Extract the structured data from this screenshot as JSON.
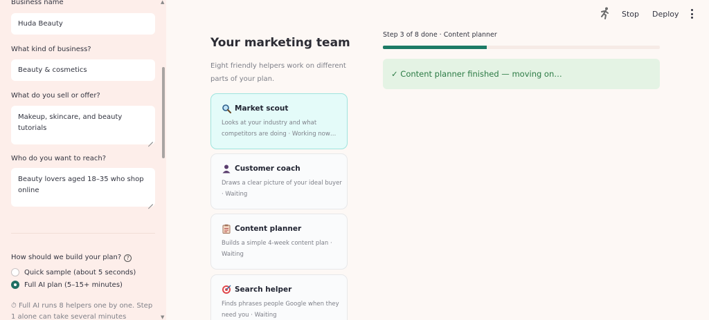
{
  "sidebar": {
    "business_name": {
      "label": "Business name",
      "value": "Huda Beauty"
    },
    "business_kind": {
      "label": "What kind of business?",
      "value": "Beauty & cosmetics"
    },
    "offer": {
      "label": "What do you sell or offer?",
      "value": "Makeup, skincare, and beauty tutorials"
    },
    "audience": {
      "label": "Who do you want to reach?",
      "value": "Beauty lovers aged 18–35 who shop online"
    },
    "build_plan": {
      "label": "How should we build your plan?",
      "help_glyph": "?",
      "options": [
        {
          "label": "Quick sample (about 5 seconds)",
          "selected": false
        },
        {
          "label": "Full AI plan (5–15+ minutes)",
          "selected": true
        }
      ]
    },
    "note": "⏱ Full AI runs 8 helpers one by one. Step 1 alone can take several minutes"
  },
  "toolbar": {
    "stop_label": "Stop",
    "deploy_label": "Deploy"
  },
  "team": {
    "title": "Your marketing team",
    "subtitle": "Eight friendly helpers work on different parts of your plan.",
    "helpers": [
      {
        "icon": "magnifier-icon",
        "name": "Market scout",
        "desc": "Looks at your industry and what competitors are doing · Working now…",
        "active": true
      },
      {
        "icon": "person-icon",
        "name": "Customer coach",
        "desc": "Draws a clear picture of your ideal buyer · Waiting",
        "active": false
      },
      {
        "icon": "clipboard-icon",
        "name": "Content planner",
        "desc": "Builds a simple 4-week content plan · Waiting",
        "active": false
      },
      {
        "icon": "target-icon",
        "name": "Search helper",
        "desc": "Finds phrases people Google when they need you · Waiting",
        "active": false
      }
    ]
  },
  "progress": {
    "text": "Step 3 of 8 done · Content planner",
    "completed_steps": 3,
    "total_steps": 8,
    "color": "#1c7a65"
  },
  "status": {
    "message": "✓ Content planner finished — moving on…"
  }
}
